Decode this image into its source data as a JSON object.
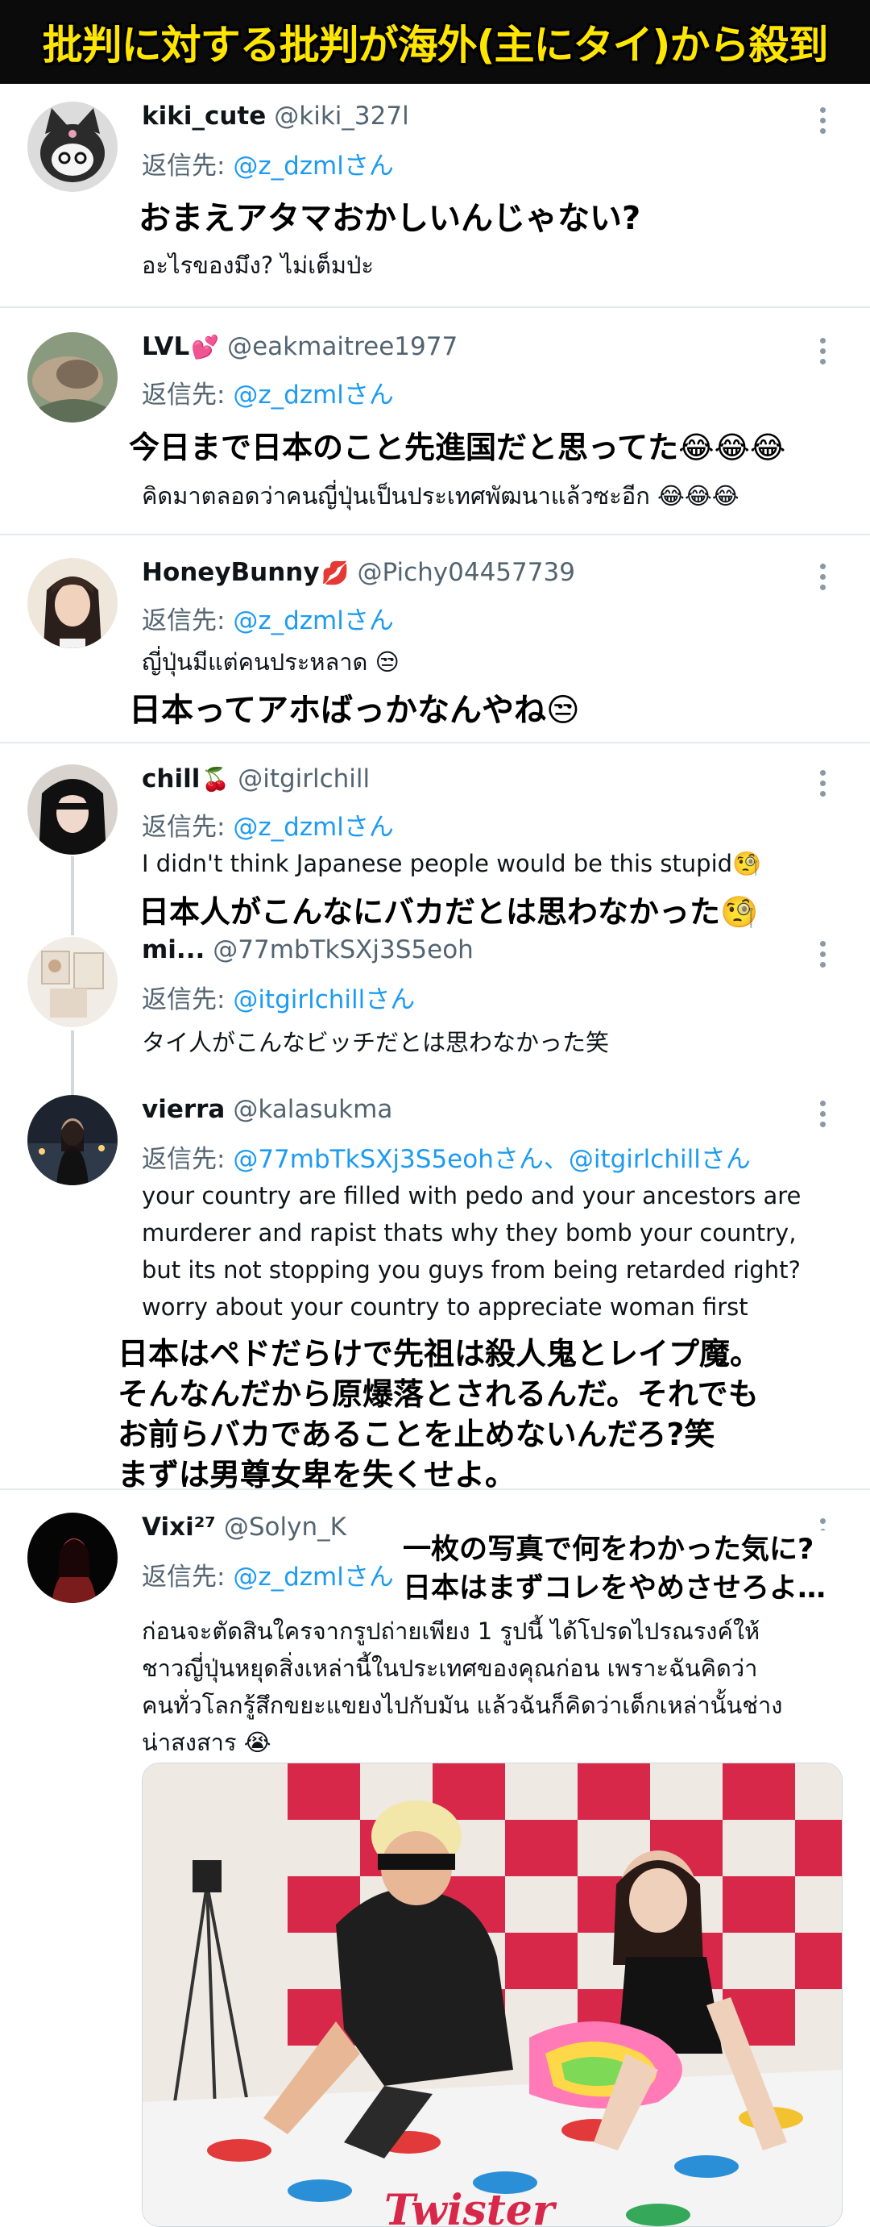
{
  "banner": {
    "title": "批判に対する批判が海外(主にタイ)から殺到"
  },
  "tweets": [
    {
      "name": "kiki_cute",
      "name_emoji": "",
      "handle": "@kiki_327l",
      "reply_prefix": "返信先: ",
      "reply_to": "@z_dzmlさん",
      "caption": "おまえアタマおかしいんじゃない?",
      "text": "อะไรของมึง? ไม่เต็มป่ะ"
    },
    {
      "name": "LVL",
      "name_emoji": "💕",
      "handle": "@eakmaitree1977",
      "reply_prefix": "返信先: ",
      "reply_to": "@z_dzmlさん",
      "caption": "今日まで日本のこと先進国だと思ってた😂😂😂",
      "text": "คิดมาตลอดว่าคนญี่ปุ่นเป็นประเทศพัฒนาแล้วซะอีก 😂😂😂"
    },
    {
      "name": "HoneyBunny",
      "name_emoji": "💋",
      "handle": "@Pichy04457739",
      "reply_prefix": "返信先: ",
      "reply_to": "@z_dzmlさん",
      "text": "ญี่ปุ่นมีแต่คนประหลาด 😒",
      "caption": "日本ってアホばっかなんやね😒"
    },
    {
      "name": "chill",
      "name_emoji": "🍒",
      "handle": "@itgirlchill",
      "reply_prefix": "返信先: ",
      "reply_to": "@z_dzmlさん",
      "text": "I didn't think Japanese people would be this stupid🧐",
      "caption": "日本人がこんなにバカだとは思わなかった🧐"
    },
    {
      "name": "mi...",
      "name_emoji": "",
      "handle": "@77mbTkSXj3S5eoh",
      "reply_prefix": "返信先: ",
      "reply_to": "@itgirlchillさん",
      "text": "タイ人がこんなビッチだとは思わなかった笑"
    },
    {
      "name": "vierra",
      "name_emoji": "",
      "handle": "@kalasukma",
      "reply_prefix": "返信先: ",
      "reply_to": "@77mbTkSXj3S5eohさん、@itgirlchillさん",
      "text_lines": [
        "your country are filled with pedo and your ancestors are",
        "murderer and rapist thats why they bomb your country,",
        "but its not stopping you guys from being retarded right?",
        "worry about your country to appreciate woman first"
      ],
      "caption_lines": [
        "日本はペドだらけで先祖は殺人鬼とレイプ魔。",
        "そんなんだから原爆落とされるんだ。それでも",
        "お前らバカであることを止めないんだろ?笑",
        "まずは男尊女卑を失くせよ。"
      ]
    },
    {
      "name": "Vixi²⁷",
      "name_emoji": "",
      "handle": "@Solyn_K",
      "reply_prefix": "返信先: ",
      "reply_to": "@z_dzmlさん",
      "note_lines": [
        "一枚の写真で何をわかった気に?",
        "日本はまずコレをやめさせろよ…"
      ],
      "text_lines": [
        "ก่อนจะตัดสินใครจากรูปถ่ายเพียง 1 รูปนี้ ได้โปรดไปรณรงค์ให้",
        "ชาวญี่ปุ่นหยุดสิ่งเหล่านี้ในประเทศของคุณก่อน เพราะฉันคิดว่า",
        "คนทั่วโลกรู้สึกขยะแขยงไปกับมัน แล้วฉันก็คิดว่าเด็กเหล่านั้นช่าง",
        "น่าสงสาร 😭"
      ],
      "photo_mat_text": "Twister"
    }
  ],
  "colors": {
    "mention": "#1d9bf0",
    "secondary": "#536471",
    "banner_text": "#ffe600"
  },
  "icons": [
    "more-vertical-icon"
  ]
}
